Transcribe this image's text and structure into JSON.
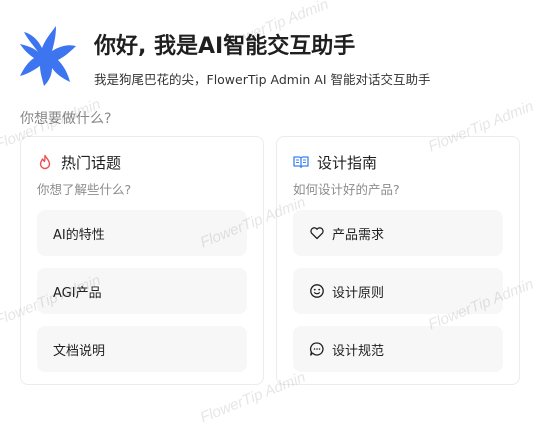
{
  "header": {
    "title": "你好, 我是AI智能交互助手",
    "subtitle": "我是狗尾巴花的尖，FlowerTip Admin AI 智能对话交互助手"
  },
  "prompt": "你想要做什么?",
  "cards": [
    {
      "title": "热门话题",
      "desc": "你想了解些什么?",
      "icon": "fire-icon",
      "items": [
        {
          "label": "AI的特性"
        },
        {
          "label": "AGI产品"
        },
        {
          "label": "文档说明"
        }
      ]
    },
    {
      "title": "设计指南",
      "desc": "如何设计好的产品?",
      "icon": "book-icon",
      "items": [
        {
          "label": "产品需求",
          "icon": "heart-icon"
        },
        {
          "label": "设计原则",
          "icon": "smile-icon"
        },
        {
          "label": "设计规范",
          "icon": "comment-icon"
        }
      ]
    }
  ],
  "watermark": "FlowerTip Admin",
  "colors": {
    "logo": "#3d74f0",
    "fire": "#ef4e4e",
    "book": "#3b82f6"
  }
}
